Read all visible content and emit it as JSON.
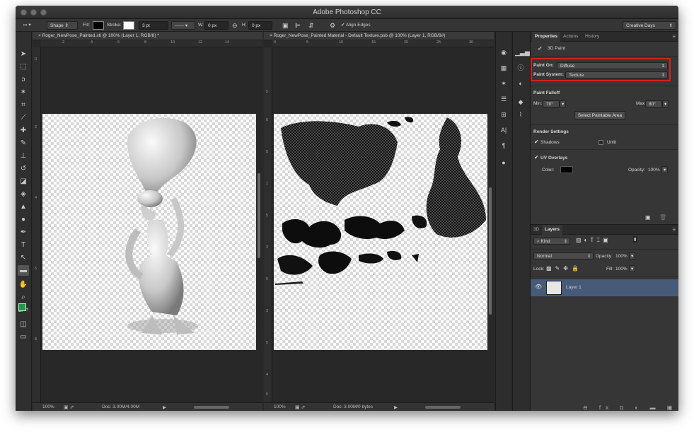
{
  "window": {
    "title": "Adobe Photoshop CC"
  },
  "options_bar": {
    "shape_mode": "Shape",
    "fill_label": "Fill:",
    "stroke_label": "Stroke:",
    "stroke_size": "3 pt",
    "w_label": "W:",
    "w_value": "0 px",
    "h_label": "H:",
    "h_value": "0 px",
    "align_edges": "Align Edges",
    "workspace": "Creative Days"
  },
  "doc1": {
    "tab": "Roger_NewPose_Painted.stl @ 100% (Layer 1, RGB/8) *",
    "zoom": "100%",
    "doc_size": "Doc: 3.00M/4.00M",
    "ruler_h": [
      "2",
      "4",
      "6",
      "8",
      "10",
      "12",
      "14"
    ],
    "ruler_v": [
      "0",
      "2",
      "4",
      "6",
      "8"
    ]
  },
  "doc2": {
    "tab": "Roger_NewPose_Painted Material - Default Texture.psb @ 100% (Layer 1, RGB/8#)",
    "zoom": "100%",
    "doc_size": "Doc: 3.00M/0 bytes",
    "ruler_h": [
      "0",
      "5",
      "10",
      "15",
      "20",
      "25",
      "30"
    ],
    "ruler_v": [
      "5",
      "0",
      "5",
      "1",
      "5",
      "2",
      "5",
      "3",
      "5",
      "4",
      "5"
    ]
  },
  "properties": {
    "tabs": [
      "Properties",
      "Actions",
      "History"
    ],
    "section_title": "3D Paint",
    "paint_on_label": "Paint On:",
    "paint_on_value": "Diffuse",
    "paint_system_label": "Paint System:",
    "paint_system_value": "Texture",
    "falloff_title": "Paint Falloff",
    "min_label": "Min:",
    "min_value": "70°",
    "max_label": "Max:",
    "max_value": "80°",
    "select_area_button": "Select Paintable Area",
    "render_title": "Render Settings",
    "shadows_label": "Shadows",
    "unlit_label": "Unlit",
    "uv_label": "UV Overlays",
    "color_label": "Color:",
    "opacity_label": "Opacity:",
    "opacity_value": "100%"
  },
  "layers": {
    "tabs": [
      "3D",
      "Layers"
    ],
    "filter_kind": "Kind",
    "blend_mode": "Normal",
    "opacity_label": "Opacity:",
    "opacity_value": "100%",
    "lock_label": "Lock:",
    "fill_label": "Fill:",
    "fill_value": "100%",
    "layer_name": "Layer 1"
  },
  "colors": {
    "foreground": "#1e9a4a",
    "highlight": "#d42020",
    "layer_selected": "#475a78"
  }
}
